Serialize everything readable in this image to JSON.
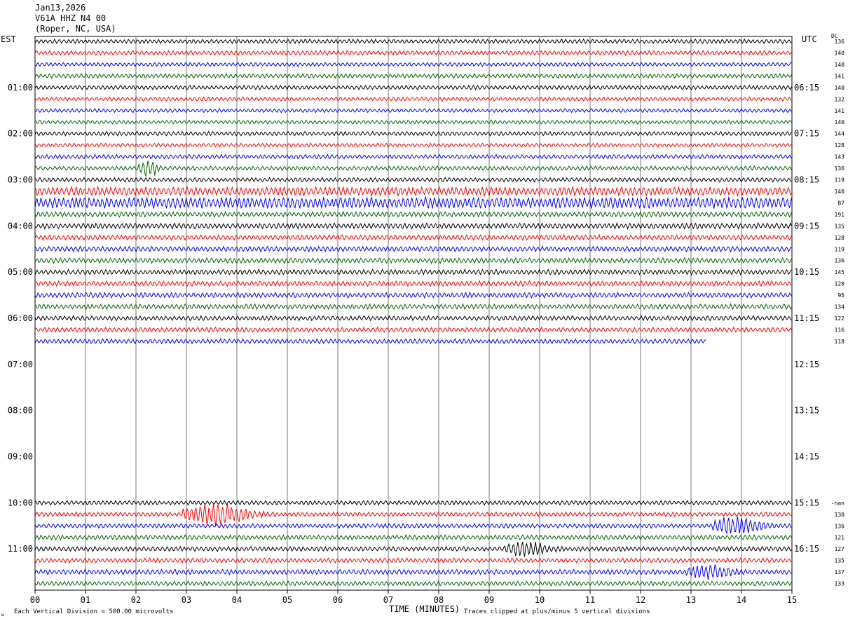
{
  "header": {
    "date": "Jan13,2026",
    "station": "V61A HHZ N4 00",
    "location": "(Roper, NC, USA)"
  },
  "left_timezone": "EST",
  "right_timezone": "UTC",
  "dc_header": "DC",
  "footer": {
    "scale_note": "Each Vertical Division =  500.00 microvolts",
    "xlabel": "TIME (MINUTES)",
    "clip_note": "Traces clipped at plus/minus 5 vertical divisions",
    "corner_mark": "»"
  },
  "chart_data": {
    "type": "line",
    "subtype": "helicorder",
    "x_range_minutes": [
      0,
      15
    ],
    "x_ticks": [
      "00",
      "01",
      "02",
      "03",
      "04",
      "05",
      "06",
      "07",
      "08",
      "09",
      "10",
      "11",
      "12",
      "13",
      "14",
      "15"
    ],
    "minutes_per_row": 15,
    "rows_total": 48,
    "trace_colors": [
      "#000000",
      "#ff0000",
      "#0000ff",
      "#006400"
    ],
    "est_hour_labels": [
      {
        "row": 4,
        "text": "01:00"
      },
      {
        "row": 8,
        "text": "02:00"
      },
      {
        "row": 12,
        "text": "03:00"
      },
      {
        "row": 16,
        "text": "04:00"
      },
      {
        "row": 20,
        "text": "05:00"
      },
      {
        "row": 24,
        "text": "06:00"
      },
      {
        "row": 28,
        "text": "07:00"
      },
      {
        "row": 32,
        "text": "08:00"
      },
      {
        "row": 36,
        "text": "09:00"
      },
      {
        "row": 40,
        "text": "10:00"
      },
      {
        "row": 44,
        "text": "11:00"
      }
    ],
    "utc_hour_labels": [
      {
        "row": 4,
        "text": "06:15"
      },
      {
        "row": 8,
        "text": "07:15"
      },
      {
        "row": 12,
        "text": "08:15"
      },
      {
        "row": 16,
        "text": "09:15"
      },
      {
        "row": 20,
        "text": "10:15"
      },
      {
        "row": 24,
        "text": "11:15"
      },
      {
        "row": 28,
        "text": "12:15"
      },
      {
        "row": 32,
        "text": "13:15"
      },
      {
        "row": 36,
        "text": "14:15"
      },
      {
        "row": 40,
        "text": "15:15"
      },
      {
        "row": 44,
        "text": "16:15"
      }
    ],
    "dc_offsets": [
      {
        "row": 0,
        "text": "136"
      },
      {
        "row": 1,
        "text": "140"
      },
      {
        "row": 2,
        "text": "140"
      },
      {
        "row": 3,
        "text": "141"
      },
      {
        "row": 4,
        "text": "140"
      },
      {
        "row": 5,
        "text": "132"
      },
      {
        "row": 6,
        "text": "141"
      },
      {
        "row": 7,
        "text": "140"
      },
      {
        "row": 8,
        "text": "144"
      },
      {
        "row": 9,
        "text": "128"
      },
      {
        "row": 10,
        "text": "143"
      },
      {
        "row": 11,
        "text": "136"
      },
      {
        "row": 12,
        "text": "119"
      },
      {
        "row": 13,
        "text": "140"
      },
      {
        "row": 14,
        "text": "87"
      },
      {
        "row": 15,
        "text": "191"
      },
      {
        "row": 16,
        "text": "135"
      },
      {
        "row": 17,
        "text": "128"
      },
      {
        "row": 18,
        "text": "119"
      },
      {
        "row": 19,
        "text": "136"
      },
      {
        "row": 20,
        "text": "145"
      },
      {
        "row": 21,
        "text": "120"
      },
      {
        "row": 22,
        "text": "95"
      },
      {
        "row": 23,
        "text": "134"
      },
      {
        "row": 24,
        "text": "122"
      },
      {
        "row": 25,
        "text": "116"
      },
      {
        "row": 26,
        "text": "118"
      },
      {
        "row": 40,
        "text": "-nan"
      },
      {
        "row": 41,
        "text": "130"
      },
      {
        "row": 42,
        "text": "136"
      },
      {
        "row": 43,
        "text": "121"
      },
      {
        "row": 44,
        "text": "127"
      },
      {
        "row": 45,
        "text": "135"
      },
      {
        "row": 46,
        "text": "137"
      },
      {
        "row": 47,
        "text": "133"
      }
    ],
    "traces": [
      {
        "row": 0,
        "end_min": 15,
        "amp": 1.0
      },
      {
        "row": 1,
        "end_min": 15,
        "amp": 1.0
      },
      {
        "row": 2,
        "end_min": 15,
        "amp": 0.9
      },
      {
        "row": 3,
        "end_min": 15,
        "amp": 1.0
      },
      {
        "row": 4,
        "end_min": 15,
        "amp": 1.0
      },
      {
        "row": 5,
        "end_min": 15,
        "amp": 0.9
      },
      {
        "row": 6,
        "end_min": 15,
        "amp": 0.9
      },
      {
        "row": 7,
        "end_min": 15,
        "amp": 0.9
      },
      {
        "row": 8,
        "end_min": 15,
        "amp": 1.0
      },
      {
        "row": 9,
        "end_min": 15,
        "amp": 0.9
      },
      {
        "row": 10,
        "end_min": 15,
        "amp": 1.0
      },
      {
        "row": 11,
        "end_min": 15,
        "amp": 1.0
      },
      {
        "row": 12,
        "end_min": 15,
        "amp": 1.0
      },
      {
        "row": 13,
        "end_min": 15,
        "amp": 2.0
      },
      {
        "row": 14,
        "end_min": 15,
        "amp": 2.6
      },
      {
        "row": 15,
        "end_min": 15,
        "amp": 1.2
      },
      {
        "row": 16,
        "end_min": 15,
        "amp": 1.3
      },
      {
        "row": 17,
        "end_min": 15,
        "amp": 1.2
      },
      {
        "row": 18,
        "end_min": 15,
        "amp": 1.2
      },
      {
        "row": 19,
        "end_min": 15,
        "amp": 1.2
      },
      {
        "row": 20,
        "end_min": 15,
        "amp": 1.2
      },
      {
        "row": 21,
        "end_min": 15,
        "amp": 1.2
      },
      {
        "row": 22,
        "end_min": 15,
        "amp": 1.2
      },
      {
        "row": 23,
        "end_min": 15,
        "amp": 1.2
      },
      {
        "row": 24,
        "end_min": 15,
        "amp": 1.1
      },
      {
        "row": 25,
        "end_min": 15,
        "amp": 1.1
      },
      {
        "row": 26,
        "end_min": 13.3,
        "amp": 1.1
      },
      {
        "row": 40,
        "start_min": 0,
        "end_min": 15,
        "amp": 1.0
      },
      {
        "row": 41,
        "end_min": 15,
        "amp": 1.0
      },
      {
        "row": 42,
        "end_min": 15,
        "amp": 1.0
      },
      {
        "row": 43,
        "end_min": 15,
        "amp": 1.1
      },
      {
        "row": 44,
        "end_min": 15,
        "amp": 1.1
      },
      {
        "row": 45,
        "end_min": 15,
        "amp": 1.1
      },
      {
        "row": 46,
        "end_min": 15,
        "amp": 1.2
      },
      {
        "row": 47,
        "end_min": 15,
        "amp": 1.1
      }
    ],
    "events": [
      {
        "row": 11,
        "start_min": 2.05,
        "end_min": 2.6,
        "amp": 4.0
      },
      {
        "row": 41,
        "start_min": 2.9,
        "end_min": 4.8,
        "amp": 4.5
      },
      {
        "row": 42,
        "start_min": 13.4,
        "end_min": 14.8,
        "amp": 4.0
      },
      {
        "row": 44,
        "start_min": 9.3,
        "end_min": 10.5,
        "amp": 3.2
      },
      {
        "row": 46,
        "start_min": 12.9,
        "end_min": 14.2,
        "amp": 2.5
      }
    ]
  }
}
